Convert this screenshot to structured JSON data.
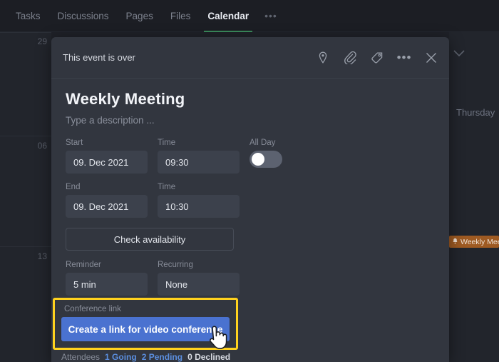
{
  "topnav": {
    "tabs": [
      {
        "label": "Tasks",
        "active": false
      },
      {
        "label": "Discussions",
        "active": false
      },
      {
        "label": "Pages",
        "active": false
      },
      {
        "label": "Files",
        "active": false
      },
      {
        "label": "Calendar",
        "active": true
      }
    ],
    "overflow_label": "•••"
  },
  "calendar_bg": {
    "row_labels": [
      "29",
      "06",
      "13"
    ],
    "day_header": "Thursday",
    "event_chip": {
      "icon": "bell-icon",
      "label": "Weekly Mee"
    },
    "accent_green": "#3b8b5c",
    "event_chip_color": "#9e5a22"
  },
  "dialog": {
    "status_text": "This event is over",
    "actions": [
      {
        "name": "location-icon",
        "title": "Location"
      },
      {
        "name": "attachment-icon",
        "title": "Attachment"
      },
      {
        "name": "tag-icon",
        "title": "Tag"
      },
      {
        "name": "more-icon",
        "title": "More"
      },
      {
        "name": "close-icon",
        "title": "Close"
      }
    ],
    "title": "Weekly Meeting",
    "description_placeholder": "Type a description ...",
    "fields": {
      "start_label": "Start",
      "start_value": "09. Dec 2021",
      "start_time_label": "Time",
      "start_time_value": "09:30",
      "all_day_label": "All Day",
      "all_day_on": false,
      "end_label": "End",
      "end_value": "09. Dec 2021",
      "end_time_label": "Time",
      "end_time_value": "10:30",
      "reminder_label": "Reminder",
      "reminder_value": "5 min",
      "recurring_label": "Recurring",
      "recurring_value": "None"
    },
    "check_availability_label": "Check availability",
    "conference_label": "Conference link",
    "conference_button_label": "Create a link for video conference",
    "conference_button_color": "#4a72d0",
    "highlight_color": "#ffd21e",
    "attendees": {
      "label": "Attendees",
      "going": "1 Going",
      "pending": "2 Pending",
      "declined": "0 Declined"
    }
  }
}
